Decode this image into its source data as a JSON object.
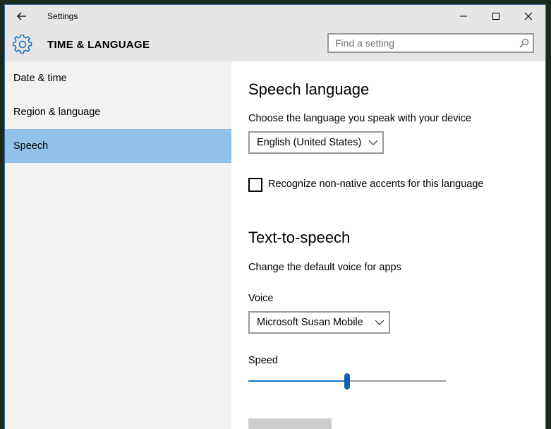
{
  "window": {
    "title": "Settings",
    "section_title": "TIME & LANGUAGE"
  },
  "search": {
    "placeholder": "Find a setting",
    "value": ""
  },
  "sidebar": {
    "items": [
      {
        "label": "Date & time",
        "selected": false
      },
      {
        "label": "Region & language",
        "selected": false
      },
      {
        "label": "Speech",
        "selected": true
      }
    ]
  },
  "speech_language": {
    "heading": "Speech language",
    "description": "Choose the language you speak with your device",
    "selected_language": "English (United States)",
    "accents_checkbox_label": "Recognize non-native accents for this language",
    "accents_checked": false
  },
  "tts": {
    "heading": "Text-to-speech",
    "description": "Change the default voice for apps",
    "voice_label": "Voice",
    "selected_voice": "Microsoft Susan Mobile",
    "speed_label": "Speed",
    "speed_fraction": 0.5
  },
  "colors": {
    "accent": "#1874c3",
    "selected_nav": "#92c1e9",
    "chrome": "#e6e6e6",
    "sidebar": "#f2f2f2"
  },
  "icons": [
    "back-arrow-icon",
    "minimize-icon",
    "maximize-icon",
    "close-icon",
    "gear-icon",
    "search-icon",
    "chevron-down-icon"
  ]
}
